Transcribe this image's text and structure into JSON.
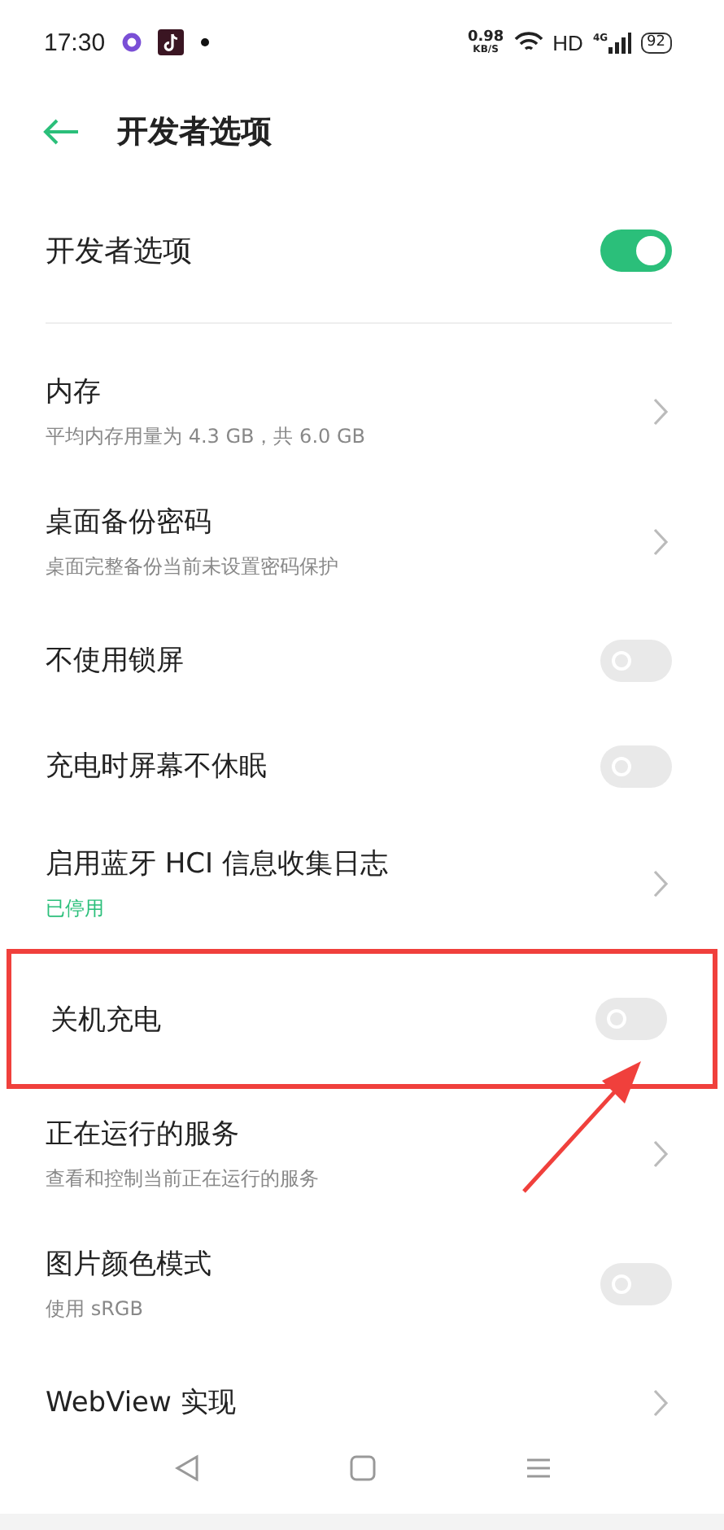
{
  "status_bar": {
    "time": "17:30",
    "speed": "0.98",
    "speed_unit": "KB/S",
    "hd": "HD",
    "network": "4G",
    "battery": "92"
  },
  "header": {
    "title": "开发者选项"
  },
  "master": {
    "label": "开发者选项",
    "on": true
  },
  "items": [
    {
      "kind": "link",
      "title": "内存",
      "subtitle": "平均内存用量为 4.3 GB，共 6.0 GB",
      "highlighted": false
    },
    {
      "kind": "link",
      "title": "桌面备份密码",
      "subtitle": "桌面完整备份当前未设置密码保护",
      "highlighted": false
    },
    {
      "kind": "switch",
      "title": "不使用锁屏",
      "on": false,
      "highlighted": false
    },
    {
      "kind": "switch",
      "title": "充电时屏幕不休眠",
      "on": false,
      "highlighted": false
    },
    {
      "kind": "link",
      "title": "启用蓝牙 HCI 信息收集日志",
      "status": "已停用",
      "highlighted": false
    },
    {
      "kind": "switch",
      "title": "关机充电",
      "on": false,
      "highlighted": true
    },
    {
      "kind": "link",
      "title": "正在运行的服务",
      "subtitle": "查看和控制当前正在运行的服务",
      "highlighted": false
    },
    {
      "kind": "switch",
      "title": "图片颜色模式",
      "subtitle": "使用 sRGB",
      "on": false,
      "highlighted": false
    },
    {
      "kind": "link",
      "title": "WebView 实现",
      "highlighted": false
    }
  ]
}
